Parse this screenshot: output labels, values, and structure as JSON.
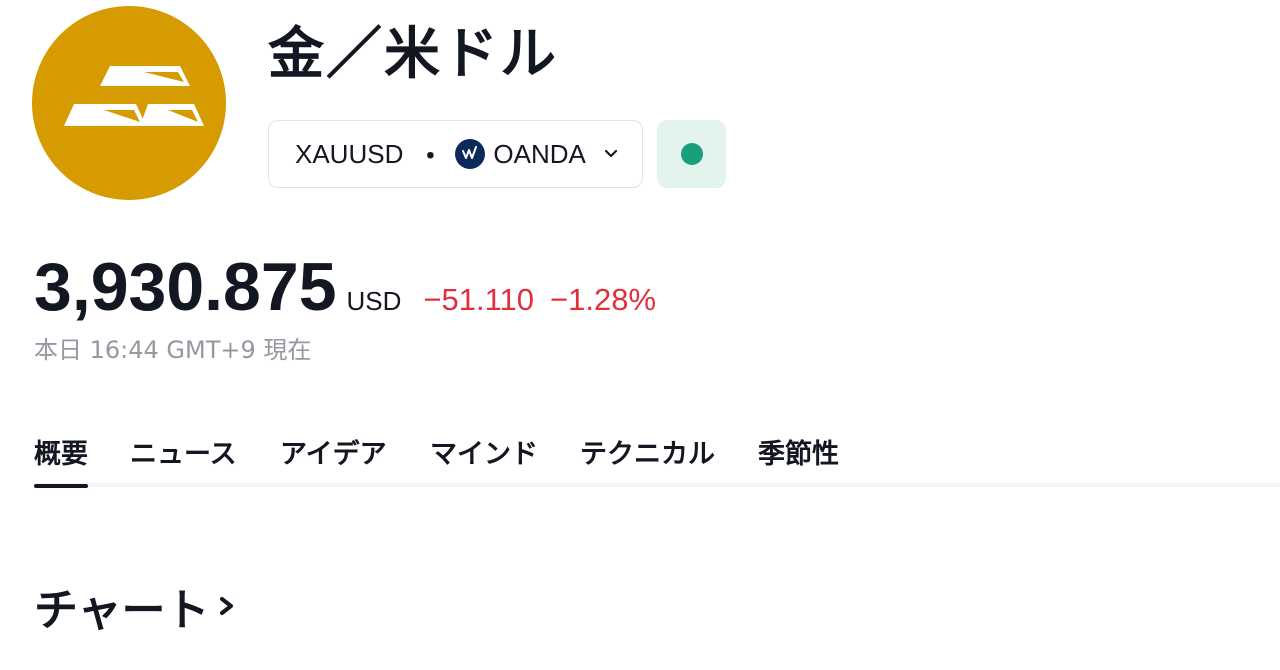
{
  "header": {
    "title": "金／米ドル",
    "logo_icon": "gold-bars-icon",
    "logo_color": "#d59b00"
  },
  "symbol": {
    "ticker": "XAUUSD",
    "separator": "・",
    "exchange": "OANDA",
    "exchange_icon": "oanda-icon",
    "dropdown_icon": "chevron-down-icon"
  },
  "market_status": {
    "icon": "status-dot-icon",
    "color": "#1a9f7d"
  },
  "quote": {
    "price": "3,930.875",
    "currency": "USD",
    "change": "−51.110",
    "change_percent": "−1.28%",
    "change_color": "#e0303c",
    "timestamp": "本日 16:44 GMT+9 現在"
  },
  "tabs": [
    {
      "label": "概要",
      "active": true
    },
    {
      "label": "ニュース",
      "active": false
    },
    {
      "label": "アイデア",
      "active": false
    },
    {
      "label": "マインド",
      "active": false
    },
    {
      "label": "テクニカル",
      "active": false
    },
    {
      "label": "季節性",
      "active": false
    }
  ],
  "section": {
    "heading": "チャート",
    "chevron_icon": "chevron-right-icon"
  }
}
